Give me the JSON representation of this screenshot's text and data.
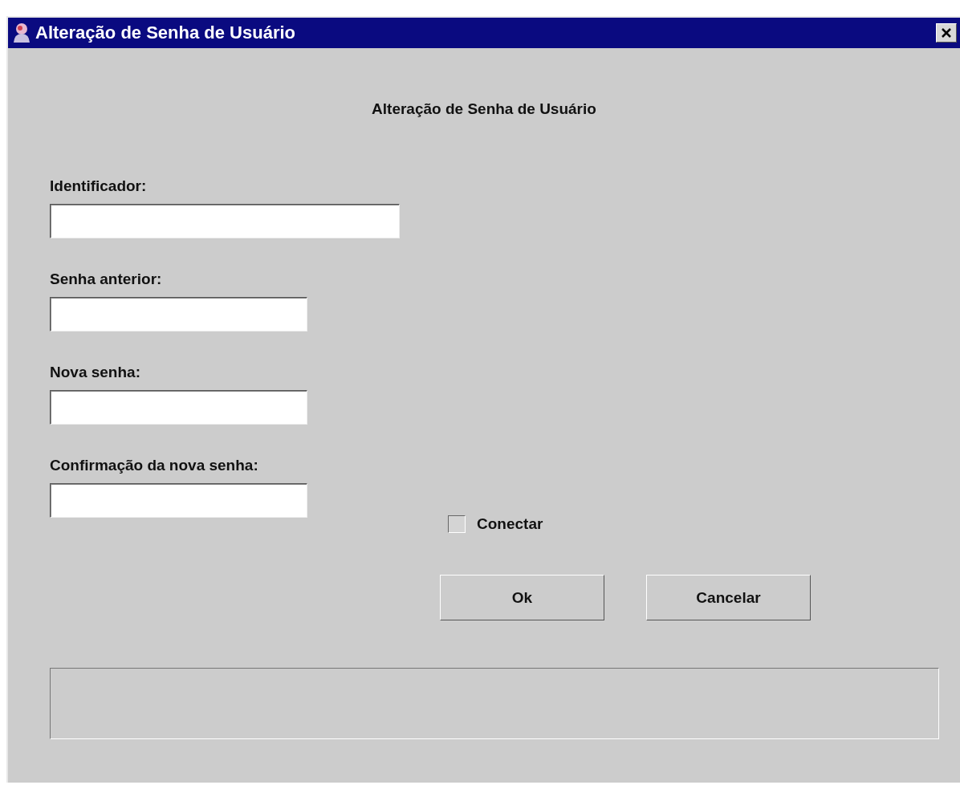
{
  "window": {
    "title": "Alteração de Senha de Usuário"
  },
  "heading": "Alteração de Senha de Usuário",
  "fields": [
    {
      "label": "Identificador:",
      "kind": "wide"
    },
    {
      "label": "Senha anterior:",
      "kind": "narrow"
    },
    {
      "label": "Nova senha:",
      "kind": "narrow"
    },
    {
      "label": "Confirmação da nova senha:",
      "kind": "narrow"
    }
  ],
  "connect": {
    "label": "Conectar",
    "checked": false
  },
  "buttons": [
    "Ok",
    "Cancelar"
  ]
}
